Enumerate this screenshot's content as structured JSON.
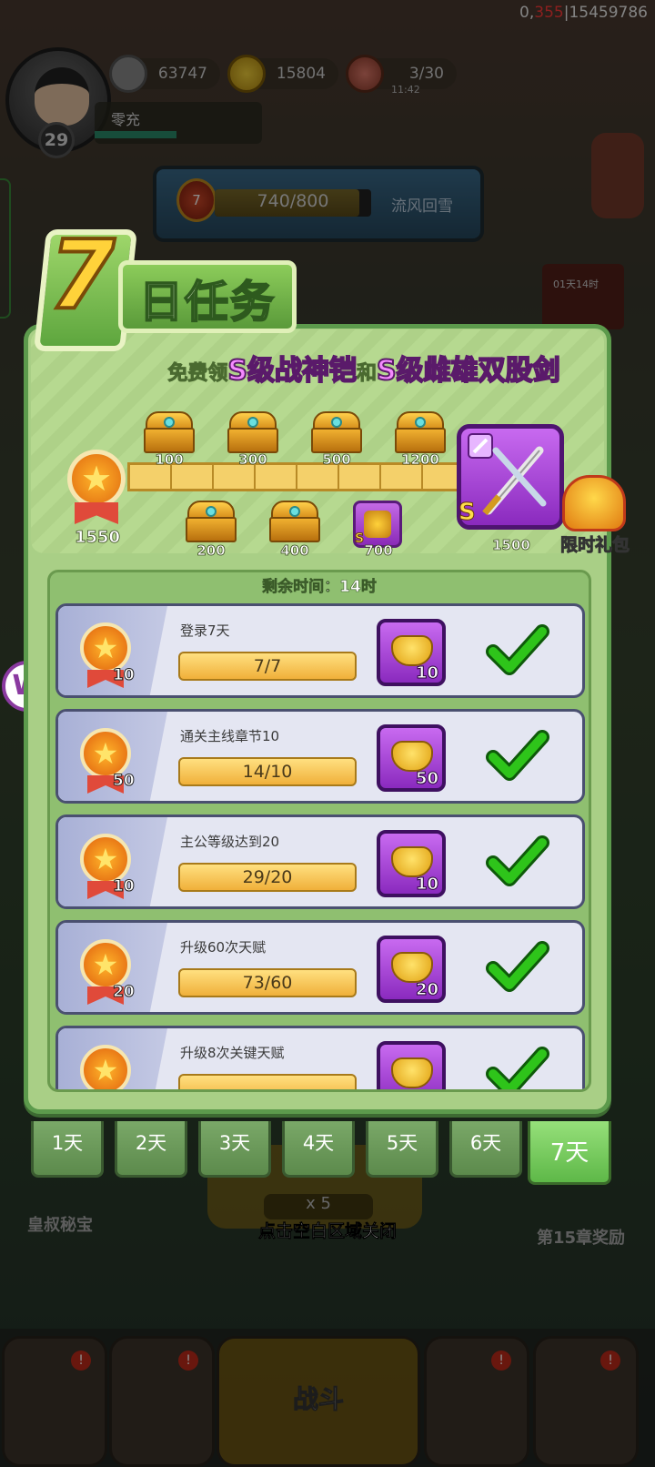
{
  "debug": {
    "prefix": "0,",
    "highlight": "355",
    "suffix": "|15459786"
  },
  "player": {
    "level": "29",
    "name": "零充"
  },
  "resources": {
    "silver": "63747",
    "gold": "15804",
    "stamina": "3/30",
    "stamina_timer": "11:42"
  },
  "stage": {
    "medal": "7",
    "progress": "740/800",
    "progress_fraction": 0.925,
    "name": "流风回雪"
  },
  "side_card": {
    "text": "01天14时"
  },
  "event": {
    "title_number": "7",
    "title": "日任务",
    "subtitle_prefix": "免费领",
    "subtitle_item1": "S级战神铠",
    "subtitle_mid": "和",
    "subtitle_item2": "S级雌雄双股剑",
    "total_points": "1550",
    "milestones_top": [
      "100",
      "300",
      "500",
      "1200"
    ],
    "milestones_bottom": [
      "200",
      "400",
      "700"
    ],
    "final_milestone": "1500",
    "gear_grade": "S",
    "gift_label": "限时礼包",
    "remaining_time": "剩余时间：14时"
  },
  "tasks": [
    {
      "title": "登录7天",
      "points": "10",
      "progress": "7/7",
      "reward": "10"
    },
    {
      "title": "通关主线章节10",
      "points": "50",
      "progress": "14/10",
      "reward": "50"
    },
    {
      "title": "主公等级达到20",
      "points": "10",
      "progress": "29/20",
      "reward": "10"
    },
    {
      "title": "升级60次天赋",
      "points": "20",
      "progress": "73/60",
      "reward": "20"
    },
    {
      "title": "升级8次关键天赋",
      "points": "",
      "progress": "",
      "reward": ""
    }
  ],
  "days": [
    "1天",
    "2天",
    "3天",
    "4天",
    "5天",
    "6天",
    "7天"
  ],
  "active_day_index": 6,
  "close_hint": "点击空白区域关闭",
  "scene": {
    "left_label": "皇叔秘宝",
    "right_label": "第15章奖励",
    "battle_cost": "x 5",
    "fight_label": "战斗",
    "battle_btn": "战斗"
  },
  "colors": {
    "panel": "#a9cf86",
    "accent_purple": "#8a2abe",
    "gold": "#f0b03a",
    "check_green": "#2ec41a"
  },
  "icons": [
    "coin-icon",
    "ingot-icon",
    "meat-icon",
    "medal-icon",
    "chest-icon",
    "sword-icon",
    "gift-icon",
    "check-icon"
  ]
}
